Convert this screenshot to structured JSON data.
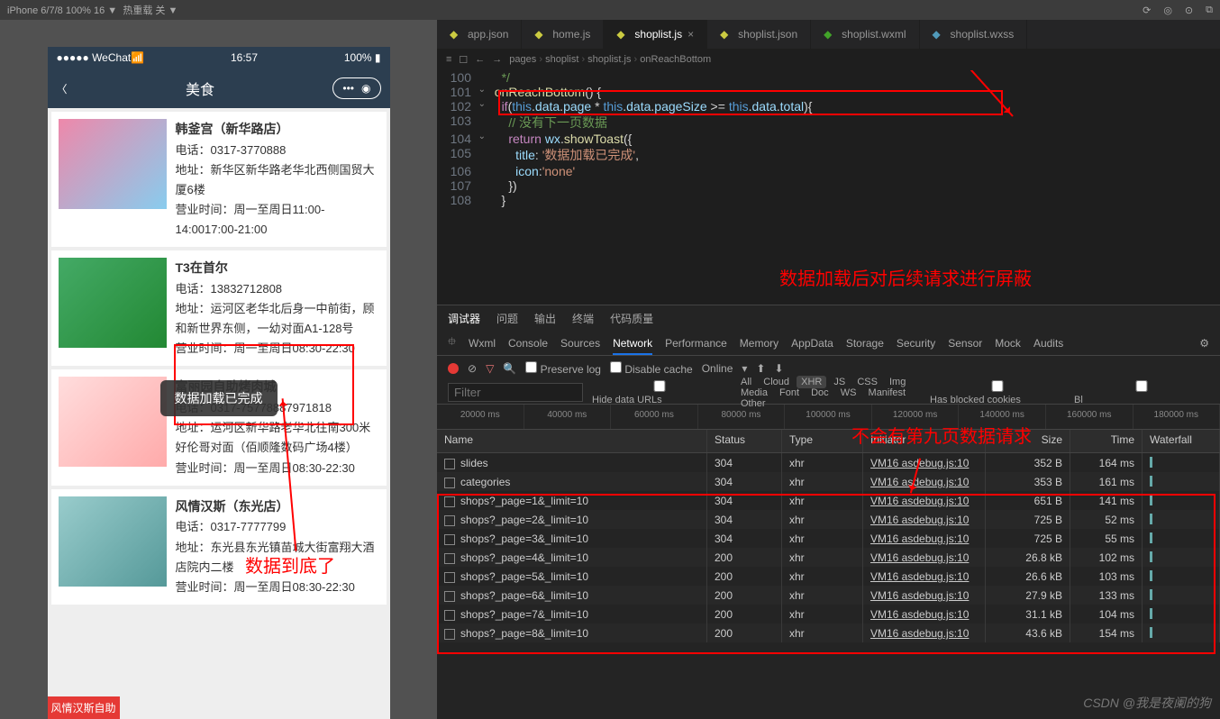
{
  "topBar": {
    "device": "iPhone 6/7/8 100% 16 ▼",
    "reload": "热重载 关 ▼"
  },
  "phone": {
    "carrier": "●●●●● WeChat",
    "signal": "📶",
    "time": "16:57",
    "battery": "100% ▮",
    "navTitle": "美食",
    "back": "〈"
  },
  "cards": [
    {
      "name": "韩釜宫（新华路店）",
      "tel": "电话：0317-3770888",
      "addr": "地址：新华区新华路老华北西侧国贸大厦6楼",
      "hours": "营业时间：周一至周日11:00-14:0017:00-21:00"
    },
    {
      "name": "T3在首尔",
      "tel": "电话：13832712808",
      "addr": "地址：运河区老华北后身一中前街，顾和新世界东侧，一幼对面A1-128号",
      "hours": "营业时间：周一至周日08:30-22:30"
    },
    {
      "name": "富丽园自助烤肉城",
      "tel": "电话：0317-75778887971818",
      "addr": "地址：运河区新华路老华北往南300米好伦哥对面（佰顺隆数码广场4楼）",
      "hours": "营业时间：周一至周日08:30-22:30"
    },
    {
      "name": "风情汉斯（东光店）",
      "tel": "电话：0317-7777799",
      "addr": "地址：东光县东光镇苗城大街富翔大酒店院内二楼",
      "hours": "营业时间：周一至周日08:30-22:30"
    }
  ],
  "toast": "数据加载已完成",
  "annotation1": "数据到底了",
  "editorTabs": [
    {
      "label": "app.json",
      "ico": "ico-json"
    },
    {
      "label": "home.js",
      "ico": "ico-js"
    },
    {
      "label": "shoplist.js",
      "ico": "ico-js",
      "active": true
    },
    {
      "label": "shoplist.json",
      "ico": "ico-json"
    },
    {
      "label": "shoplist.wxml",
      "ico": "ico-wxml"
    },
    {
      "label": "shoplist.wxss",
      "ico": "ico-wxss"
    }
  ],
  "breadcrumb": [
    "pages",
    "shoplist",
    "shoplist.js",
    "onReachBottom"
  ],
  "codeLines": [
    {
      "n": "100",
      "html": "    <span class='cm'>*/</span>"
    },
    {
      "n": "101",
      "html": "  <span class='fn'>onReachBottom</span>() {",
      "fold": "⌄"
    },
    {
      "n": "102",
      "html": "    <span class='kw'>if</span>(<span class='this'>this</span>.<span class='prop'>data</span>.<span class='prop'>page</span> * <span class='this'>this</span>.<span class='prop'>data</span>.<span class='prop'>pageSize</span> &gt;= <span class='this'>this</span>.<span class='prop'>data</span>.<span class='prop'>total</span>){",
      "fold": "⌄"
    },
    {
      "n": "103",
      "html": "      <span class='cm'>// 没有下一页数据</span>"
    },
    {
      "n": "104",
      "html": "      <span class='kw'>return</span> <span class='prop'>wx</span>.<span class='fn'>showToast</span>({",
      "fold": "⌄"
    },
    {
      "n": "105",
      "html": "        <span class='prop'>title</span>: <span class='str'>'数据加载已完成'</span>,"
    },
    {
      "n": "106",
      "html": "        <span class='prop'>icon</span>:<span class='str'>'none'</span>"
    },
    {
      "n": "107",
      "html": "      })"
    },
    {
      "n": "108",
      "html": "    }"
    }
  ],
  "annotation2": "数据加载后对后续请求进行屏蔽",
  "devTabs": [
    "调试器",
    "问题",
    "输出",
    "终端",
    "代码质量"
  ],
  "devSubTabs": [
    "Wxml",
    "Console",
    "Sources",
    "Network",
    "Performance",
    "Memory",
    "AppData",
    "Storage",
    "Security",
    "Sensor",
    "Mock",
    "Audits"
  ],
  "devActiveSub": "Network",
  "controls": {
    "preserve": "Preserve log",
    "disable": "Disable cache",
    "online": "Online"
  },
  "filter": {
    "placeholder": "Filter",
    "hide": "Hide data URLs",
    "types": [
      "All",
      "Cloud",
      "XHR",
      "JS",
      "CSS",
      "Img",
      "Media",
      "Font",
      "Doc",
      "WS",
      "Manifest",
      "Other"
    ],
    "active": "XHR",
    "blocked": "Has blocked cookies",
    "bl": "Bl"
  },
  "timeline": [
    "20000 ms",
    "40000 ms",
    "60000 ms",
    "80000 ms",
    "100000 ms",
    "120000 ms",
    "140000 ms",
    "160000 ms",
    "180000 ms"
  ],
  "netHead": {
    "name": "Name",
    "status": "Status",
    "type": "Type",
    "init": "Initiator",
    "size": "Size",
    "time": "Time",
    "wf": "Waterfall"
  },
  "netRows": [
    {
      "name": "slides",
      "status": "304",
      "type": "xhr",
      "init": "VM16 asdebug.js:10",
      "size": "352 B",
      "time": "164 ms"
    },
    {
      "name": "categories",
      "status": "304",
      "type": "xhr",
      "init": "VM16 asdebug.js:10",
      "size": "353 B",
      "time": "161 ms"
    },
    {
      "name": "shops?_page=1&_limit=10",
      "status": "304",
      "type": "xhr",
      "init": "VM16 asdebug.js:10",
      "size": "651 B",
      "time": "141 ms"
    },
    {
      "name": "shops?_page=2&_limit=10",
      "status": "304",
      "type": "xhr",
      "init": "VM16 asdebug.js:10",
      "size": "725 B",
      "time": "52 ms"
    },
    {
      "name": "shops?_page=3&_limit=10",
      "status": "304",
      "type": "xhr",
      "init": "VM16 asdebug.js:10",
      "size": "725 B",
      "time": "55 ms"
    },
    {
      "name": "shops?_page=4&_limit=10",
      "status": "200",
      "type": "xhr",
      "init": "VM16 asdebug.js:10",
      "size": "26.8 kB",
      "time": "102 ms"
    },
    {
      "name": "shops?_page=5&_limit=10",
      "status": "200",
      "type": "xhr",
      "init": "VM16 asdebug.js:10",
      "size": "26.6 kB",
      "time": "103 ms"
    },
    {
      "name": "shops?_page=6&_limit=10",
      "status": "200",
      "type": "xhr",
      "init": "VM16 asdebug.js:10",
      "size": "27.9 kB",
      "time": "133 ms"
    },
    {
      "name": "shops?_page=7&_limit=10",
      "status": "200",
      "type": "xhr",
      "init": "VM16 asdebug.js:10",
      "size": "31.1 kB",
      "time": "104 ms"
    },
    {
      "name": "shops?_page=8&_limit=10",
      "status": "200",
      "type": "xhr",
      "init": "VM16 asdebug.js:10",
      "size": "43.6 kB",
      "time": "154 ms"
    }
  ],
  "annotation3": "不会有第九页数据请求",
  "watermark": "CSDN @我是夜阑的狗",
  "bannerText": "风情汉斯自助"
}
